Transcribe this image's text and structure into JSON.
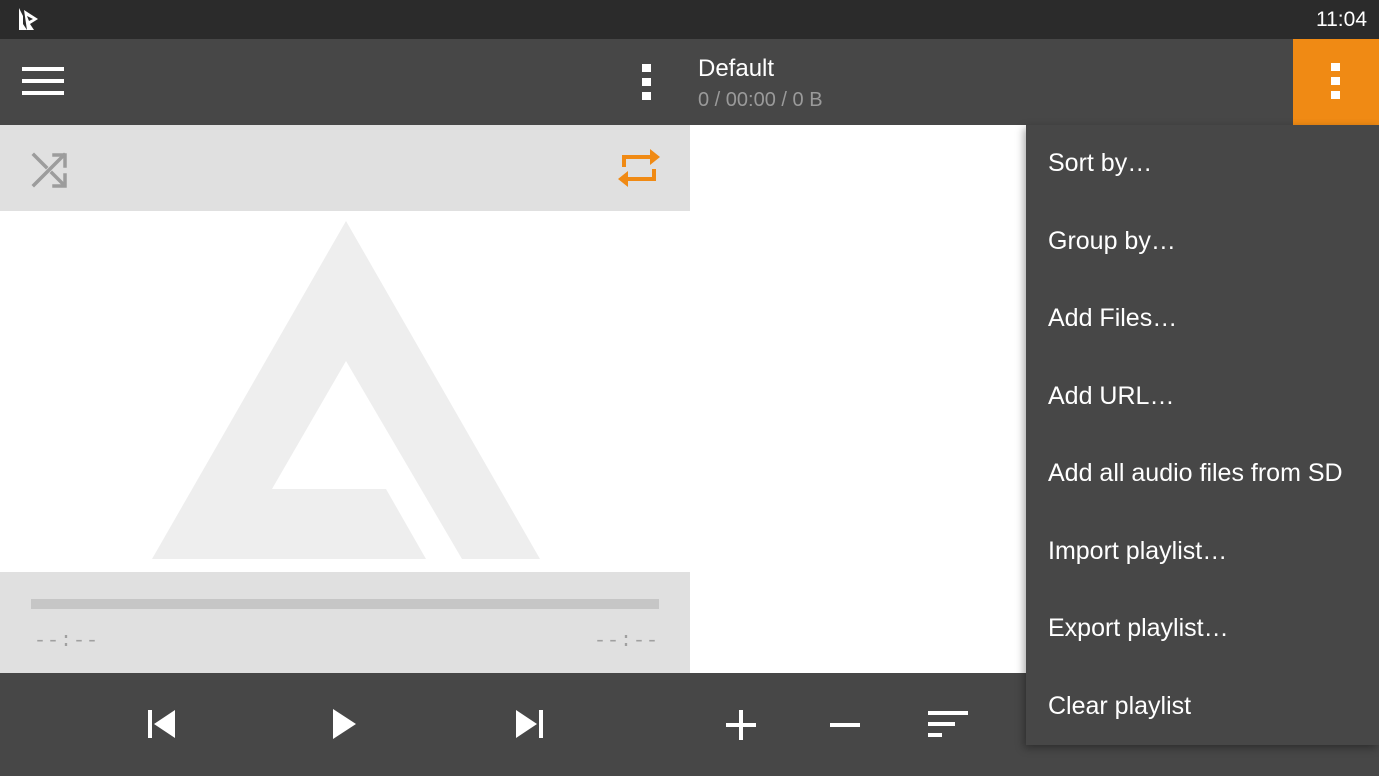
{
  "status_bar": {
    "time": "11:04",
    "app_icon": "aimp-logo-icon"
  },
  "toolbar": {
    "menu_icon": "hamburger-menu-icon",
    "left_more_icon": "more-vertical-icon",
    "playlist_title": "Default",
    "playlist_stats": "0 / 00:00 / 0 B",
    "right_more_icon": "more-vertical-icon"
  },
  "player": {
    "shuffle_icon": "shuffle-icon",
    "repeat_icon": "repeat-icon",
    "album_art_icon": "aimp-triangle-logo-icon",
    "progress": 0,
    "time_elapsed": "--:--",
    "time_remaining": "--:--"
  },
  "controls": {
    "previous_icon": "skip-previous-icon",
    "play_icon": "play-icon",
    "next_icon": "skip-next-icon",
    "add_icon": "plus-icon",
    "remove_icon": "minus-icon",
    "sort_icon": "sort-icon"
  },
  "menu": {
    "items": [
      {
        "label": "Sort by…"
      },
      {
        "label": "Group by…"
      },
      {
        "label": "Add Files…"
      },
      {
        "label": "Add URL…"
      },
      {
        "label": "Add all audio files from SD"
      },
      {
        "label": "Import playlist…"
      },
      {
        "label": "Export playlist…"
      },
      {
        "label": "Clear playlist"
      }
    ]
  },
  "colors": {
    "accent": "#f08a14",
    "toolbar": "#474747",
    "status_bar": "#2b2b2b",
    "panel": "#e0e0e0"
  }
}
